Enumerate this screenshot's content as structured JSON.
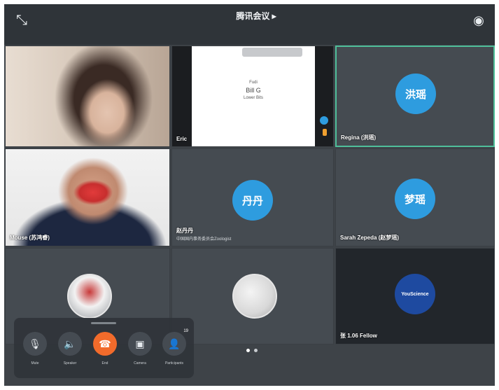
{
  "meeting": {
    "title": "腾讯会议 ▸",
    "subtitle": "",
    "pager_dots": 2
  },
  "icons": {
    "collapse": "collapse-icon",
    "camera_switch": "camera-switch-icon",
    "mic": "microphone-icon",
    "speaker": "speaker-icon",
    "end_call": "phone-end-icon",
    "video": "video-camera-icon",
    "participants": "participants-icon"
  },
  "tiles": [
    {
      "name": "",
      "type": "video"
    },
    {
      "name": "Eric",
      "type": "screen-share",
      "slide_lines": [
        "Fudi",
        "Bill G",
        "Lower Bits"
      ]
    },
    {
      "name": "Regina (洪瑶)",
      "type": "avatar",
      "avatar_text": "洪瑶",
      "active": true
    },
    {
      "name": "Mouse (苏鸿睿)",
      "type": "video"
    },
    {
      "name": "赵丹丹",
      "sub": "中国国内事务委员会Zoologist",
      "type": "avatar",
      "avatar_text": "丹丹"
    },
    {
      "name": "Sarah Zepeda (赵梦瑶)",
      "type": "avatar",
      "avatar_text": "梦瑶"
    },
    {
      "name": "",
      "type": "photo"
    },
    {
      "name": "",
      "type": "photo"
    },
    {
      "name": "张 1.06 Fellow",
      "type": "logo",
      "logo_text": "YouScience"
    }
  ],
  "controls": [
    {
      "label": "Mute",
      "icon": "microphone-icon"
    },
    {
      "label": "Speaker",
      "icon": "speaker-icon"
    },
    {
      "label": "End",
      "icon": "phone-end-icon"
    },
    {
      "label": "Camera",
      "icon": "video-camera-icon"
    },
    {
      "label": "Participants",
      "icon": "participants-icon",
      "badge": "19"
    }
  ],
  "colors": {
    "accent_blue": "#2e9cdf",
    "end_call_orange": "#f26b2b",
    "active_speaker_green": "#4fbf9a",
    "background": "#3e4348"
  }
}
